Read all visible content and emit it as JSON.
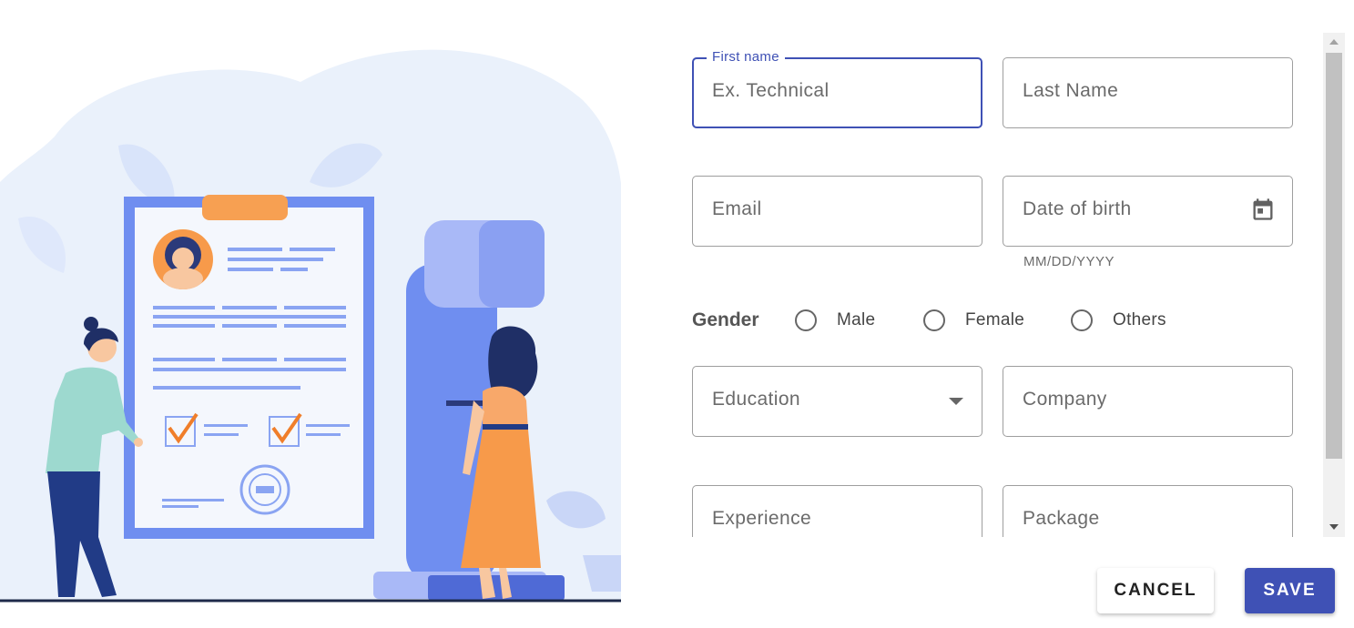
{
  "form": {
    "first_name": {
      "label": "First name",
      "placeholder": "Ex. Technical"
    },
    "last_name": {
      "placeholder": "Last Name"
    },
    "email": {
      "placeholder": "Email"
    },
    "date_of_birth": {
      "placeholder": "Date of birth",
      "hint": "MM/DD/YYYY",
      "icon": "calendar-icon"
    },
    "gender": {
      "label": "Gender",
      "options": [
        {
          "label": "Male"
        },
        {
          "label": "Female"
        },
        {
          "label": "Others"
        }
      ]
    },
    "education": {
      "placeholder": "Education",
      "icon": "dropdown-arrow-icon"
    },
    "company": {
      "placeholder": "Company"
    },
    "experience": {
      "placeholder": "Experience"
    },
    "package": {
      "placeholder": "Package"
    }
  },
  "actions": {
    "cancel_label": "CANCEL",
    "save_label": "SAVE"
  },
  "colors": {
    "accent": "#3f51b5",
    "illustration_blue": "#6f8ef0",
    "illustration_orange": "#f79a4a"
  }
}
